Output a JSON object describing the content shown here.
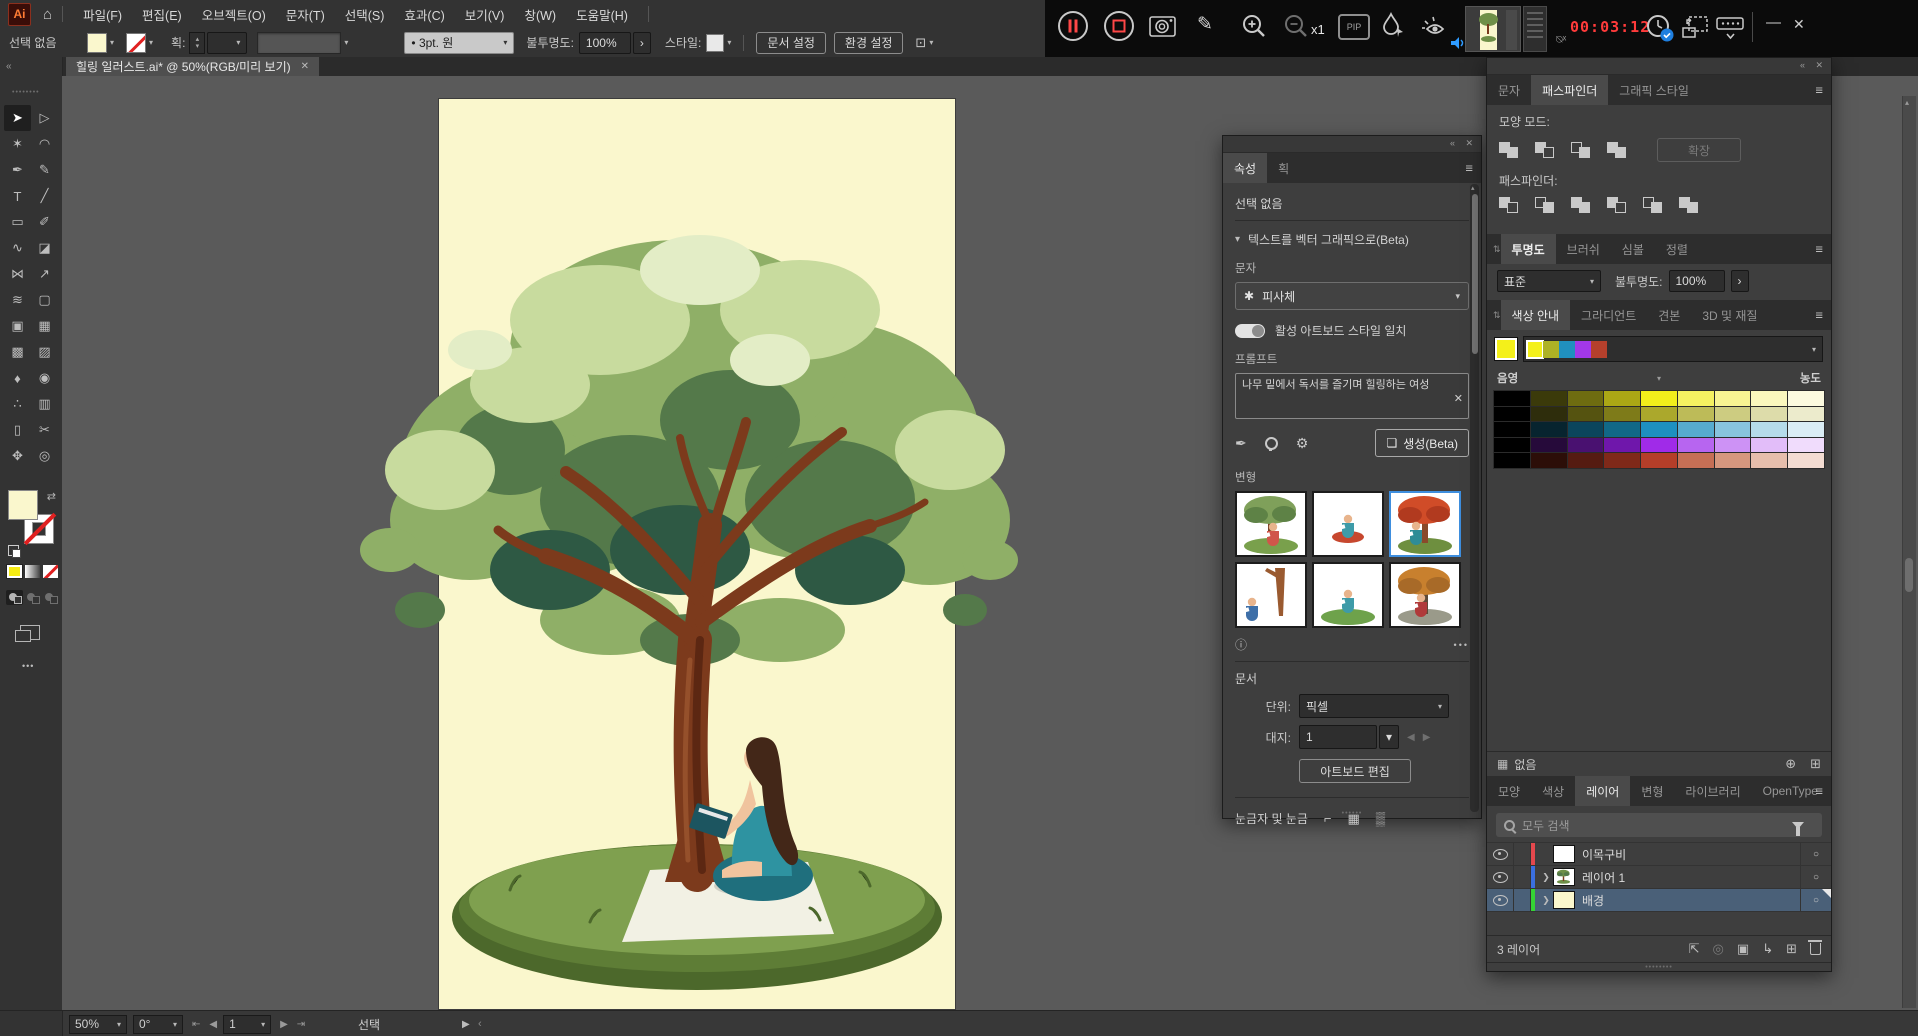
{
  "app": {
    "logo": "Ai",
    "menus": [
      "파일(F)",
      "편집(E)",
      "오브젝트(O)",
      "문자(T)",
      "선택(S)",
      "효과(C)",
      "보기(V)",
      "창(W)",
      "도움말(H)"
    ]
  },
  "icons": {
    "chevron_down": "▾",
    "chevron_up": "▴",
    "chevron_right": "›",
    "collapse": "«",
    "close": "✕",
    "menu": "≡",
    "ellipsis": "•••",
    "info": "ⓘ",
    "home": "⌂",
    "swap": "⇄",
    "target": "○",
    "first": "⇤",
    "prev": "◀",
    "next": "▶",
    "last": "⇥",
    "ruler": "⌐",
    "grid": "▦",
    "checker": "▒",
    "globe": "⊕",
    "new_group": "⊞",
    "pen": "✒",
    "gear": "⚙",
    "generate": "❏",
    "type_variant": "✱",
    "panel_updown": "⇅"
  },
  "recording": {
    "speed_label": "x1",
    "pip_label": "PIP",
    "timer": "00:03:12",
    "minimize_glyph": "—",
    "close_glyph": "✕"
  },
  "controlbar": {
    "selection_status": "선택 없음",
    "stroke_label": "획:",
    "brush_value": "• 3pt. 원",
    "opacity_label": "불투명도:",
    "opacity_value": "100%",
    "style_label": "스타일:",
    "doc_setup_button": "문서 설정",
    "preferences_button": "환경 설정"
  },
  "document_tab": {
    "title": "힐링 일러스트.ai*  @  50%(RGB/미리 보기)"
  },
  "toolbar": {
    "tools": [
      {
        "name": "selection-tool",
        "glyph": "➤",
        "active": true
      },
      {
        "name": "direct-selection-tool",
        "glyph": "▷"
      },
      {
        "name": "magic-wand-tool",
        "glyph": "✶"
      },
      {
        "name": "lasso-tool",
        "glyph": "◠"
      },
      {
        "name": "pen-tool",
        "glyph": "✒"
      },
      {
        "name": "curvature-tool",
        "glyph": "✎"
      },
      {
        "name": "type-tool",
        "glyph": "T"
      },
      {
        "name": "line-segment-tool",
        "glyph": "╱"
      },
      {
        "name": "rectangle-tool",
        "glyph": "▭"
      },
      {
        "name": "paintbrush-tool",
        "glyph": "✐"
      },
      {
        "name": "shaper-tool",
        "glyph": "∿"
      },
      {
        "name": "eraser-tool",
        "glyph": "◪"
      },
      {
        "name": "rotate-tool",
        "glyph": "⋈"
      },
      {
        "name": "scale-tool",
        "glyph": "↗"
      },
      {
        "name": "width-tool",
        "glyph": "≋"
      },
      {
        "name": "free-transform-tool",
        "glyph": "▢"
      },
      {
        "name": "shape-builder-tool",
        "glyph": "▣"
      },
      {
        "name": "perspective-grid-tool",
        "glyph": "▦"
      },
      {
        "name": "mesh-tool",
        "glyph": "▩"
      },
      {
        "name": "gradient-tool",
        "glyph": "▨"
      },
      {
        "name": "eyedropper-tool",
        "glyph": "♦"
      },
      {
        "name": "blend-tool",
        "glyph": "◉"
      },
      {
        "name": "symbol-sprayer-tool",
        "glyph": "∴"
      },
      {
        "name": "graph-tool",
        "glyph": "▥"
      },
      {
        "name": "artboard-tool",
        "glyph": "▯"
      },
      {
        "name": "slice-tool",
        "glyph": "✂"
      },
      {
        "name": "hand-tool",
        "glyph": "✥"
      },
      {
        "name": "zoom-tool",
        "glyph": "◎"
      }
    ]
  },
  "properties_panel": {
    "tabs": [
      {
        "label": "속성"
      },
      {
        "label": "획"
      }
    ],
    "no_selection": "선택 없음",
    "section_title": "텍스트를 벡터 그래픽으로(Beta)",
    "type_label": "문자",
    "type_value": "피사체",
    "toggle_label": "활성 아트보드 스타일 일치",
    "prompt_label": "프롬프트",
    "prompt_value": "나무 밑에서 독서를 즐기며 힐링하는 여성",
    "generate_button": "생성(Beta)",
    "variations_label": "변형",
    "variations": [
      {
        "canopy": "#7FA05A",
        "canopy2": "#5E8246",
        "trunk": "#7A4226",
        "ground": "#79A04C",
        "figure": "#D0564A",
        "fx": 36,
        "fy": 34,
        "selected": false
      },
      {
        "canopy": null,
        "trunk": null,
        "ground": null,
        "figure": "#3E9BA8",
        "cushion": "#C7472E",
        "fx": 34,
        "fy": 26,
        "selected": false
      },
      {
        "canopy": "#D04C28",
        "canopy2": "#B13A1F",
        "trunk": "#8A4A2A",
        "ground": "#6E8F3F",
        "figure": "#2E8C96",
        "fx": 25,
        "fy": 33,
        "selected": true
      },
      {
        "canopy": null,
        "trunk": "#9A5A30",
        "ground": null,
        "figure": "#3E6FA8",
        "fx": 15,
        "fy": 38,
        "selected": false
      },
      {
        "canopy": null,
        "trunk": null,
        "ground": "#6EA24B",
        "figure": "#3E9BA8",
        "fx": 34,
        "fy": 30,
        "selected": false
      },
      {
        "canopy": "#C8802E",
        "canopy2": "#A86A28",
        "trunk": "#5E4A38",
        "ground": "#9A9A8A",
        "figure": "#B03A3A",
        "fx": 30,
        "fy": 34,
        "selected": false
      }
    ],
    "document_label": "문서",
    "units_label": "단위:",
    "units_value": "픽셀",
    "artboard_label": "대지:",
    "artboard_value": "1",
    "edit_artboards_button": "아트보드 편집",
    "rulers_label": "눈금자 및 눈금"
  },
  "dock": {
    "pathfinder": {
      "tabs": [
        "문자",
        "패스파인더",
        "그래픽 스타일"
      ],
      "active_tab": "패스파인더",
      "shape_modes_label": "모양 모드:",
      "shape_mode_icons": [
        "unite",
        "minus-front",
        "intersect",
        "exclude"
      ],
      "expand_button": "확장",
      "pathfinder_label": "패스파인더:",
      "pathfinder_icons": [
        "divide",
        "trim",
        "merge",
        "crop",
        "outline",
        "minus-back"
      ]
    },
    "transparency": {
      "tabs": [
        "투명도",
        "브러쉬",
        "심볼",
        "정렬"
      ],
      "active_tab": "투명도",
      "blend_mode": "표준",
      "opacity_label": "불투명도:",
      "opacity_value": "100%"
    },
    "color_guide": {
      "tabs": [
        "색상 안내",
        "그라디언트",
        "견본",
        "3D 및 재질"
      ],
      "active_tab": "색상 안내",
      "base_color": "#F4F01A",
      "harmony": [
        "#F4F01A",
        "#AEB225",
        "#2090BE",
        "#A238E8",
        "#B5402C"
      ],
      "shades_label": "음영",
      "tints_label": "농도",
      "grid": [
        [
          "#000000",
          "#3B3A0A",
          "#6E6C10",
          "#ABA715",
          "#F2EE1B",
          "#F5F161",
          "#F8F492",
          "#FAF7BD",
          "#FCFADF"
        ],
        [
          "#000000",
          "#2E2D0C",
          "#555310",
          "#7E7B19",
          "#ABA82C",
          "#BDBB58",
          "#CDCC81",
          "#DDDCAA",
          "#ECEBCC"
        ],
        [
          "#000000",
          "#07242F",
          "#0B455C",
          "#116887",
          "#1E90C0",
          "#57ABCF",
          "#88C4DE",
          "#B5DBEA",
          "#DAEDF5"
        ],
        [
          "#000000",
          "#260A3A",
          "#491170",
          "#6F17AB",
          "#A02BE8",
          "#B765F0",
          "#CD92F5",
          "#E2BDF9",
          "#F0DCFC"
        ],
        [
          "#000000",
          "#2C0E08",
          "#551B11",
          "#7F2919",
          "#B53E29",
          "#C66F55",
          "#D6977E",
          "#E6BEAC",
          "#F3DCD2"
        ]
      ],
      "limit_label": "없음"
    },
    "layers_panel": {
      "tabs": [
        "모양",
        "색상",
        "레이어",
        "변형",
        "라이브러리",
        "OpenType"
      ],
      "active_tab": "레이어",
      "search_placeholder": "모두 검색",
      "layers": [
        {
          "name": "이목구비",
          "color": "#E5484D",
          "thumb": "#FFFFFF",
          "expandable": false,
          "selected": false
        },
        {
          "name": "레이어 1",
          "color": "#3B6FE0",
          "thumb": "tree",
          "expandable": true,
          "selected": false
        },
        {
          "name": "배경",
          "color": "#35D435",
          "thumb": "#FAF7CD",
          "expandable": true,
          "selected": true
        }
      ],
      "count_label": "3 레이어"
    }
  },
  "statusbar": {
    "zoom": "50%",
    "rotation": "0°",
    "artboard_nav": "1",
    "tool_name": "선택"
  },
  "artboard": {
    "color": "#FAF7CD",
    "palette": {
      "foliage_mid": "#8FAF67",
      "foliage_light": "#C8DB9E",
      "foliage_pale": "#E3EDC6",
      "foliage_dark": "#54794A",
      "foliage_deep": "#2E5944",
      "trunk": "#7C3A1C",
      "trunk_dark": "#5C2712",
      "trunk_light": "#95502B",
      "mound": "#7FA04F",
      "mound_dark": "#5E7D36",
      "mound_deep": "#4C682B",
      "blanket": "#F2F1E4",
      "skin": "#F0C49E",
      "hair": "#432718",
      "dress": "#2E93A1",
      "dress_dark": "#1F6F7D",
      "book": "#1C5560"
    }
  }
}
